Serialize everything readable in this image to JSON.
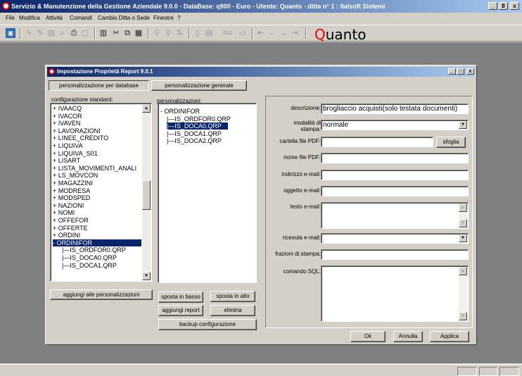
{
  "app": {
    "title": "Servizio & Manutenzione della Gestione Aziendale 9.0.0 - DataBase: q900 - Euro - Utente: Quanto - ditta n° 1 : Italsoft Sistemi",
    "window_buttons": [
      "_",
      "8",
      "x"
    ]
  },
  "menu": {
    "items": [
      "File",
      "Modifica",
      "Attività",
      "Comandi",
      "Cambio Ditta o Sede",
      "Finestre",
      "?"
    ]
  },
  "toolbar": {
    "dup_label": "dup",
    "brand_q": "Q",
    "brand_rest": "uanto",
    "brand_color": "#e00000"
  },
  "dialog": {
    "title": "Impostazione Proprietà Report 9.0.1",
    "tab_database": "personalizzazione per database",
    "tab_generale": "personalizzazione generale",
    "standard_label": "configurazione standard:",
    "custom_label": "personalizzazioni:",
    "standard_items": [
      "+ IVAACQ",
      "+ IVACOR",
      "+ IVAVEN",
      "+ LAVORAZIONI",
      "+ LINEE_CREDITO",
      "+ LIQUIVA",
      "+ LIQUIVA_S01",
      "+ LISART",
      "+ LISTA_MOVIMENTI_ANALI",
      "+ LS_MOVCON",
      "+ MAGAZZINI",
      "+ MODRESA",
      "+ MODSPED",
      "+ NAZIONI",
      "+ NOMI",
      "+ OFFEFOR",
      "+ OFFERTE",
      "+ ORDINI",
      "- ORDINIFOR",
      "|—IS_ORDFOR0.QRP",
      "|—IS_DOCA0.QRP",
      "|—IS_DOCA1.QRP"
    ],
    "standard_selected_index": 18,
    "custom_items": [
      "- ORDINIFOR",
      "|—IS_ORDFOR0.QRP",
      "|—IS_DOCA0.QRP",
      "|—IS_DOCA1.QRP",
      "|—IS_DOCA2.QRP"
    ],
    "custom_selected_index": 2,
    "buttons": {
      "aggiungi_personalizzazioni": "aggiungi alle personalizzazioni",
      "sposta_basso": "sposta in basso",
      "sposta_alto": "sposta in alto",
      "aggiungi_report": "aggiungi report",
      "elimina": "elimina",
      "backup": "backup configurazione",
      "ok": "Ok",
      "annulla": "Annulla",
      "applica": "Applica",
      "sfoglia": "sfoglia"
    },
    "form": {
      "descrizione_label": "descrizione:",
      "descrizione_value": "brogliaccio acquisti(solo testata documenti)",
      "modalita_label_1": "modalità di",
      "modalita_label_2": "stampa:",
      "modalita_value": "normale",
      "cartella_label": "cartella file PDF:",
      "cartella_value": "",
      "nome_label": "nome file PDF:",
      "nome_value": "",
      "indirizzo_label": "indirizzo e-mail:",
      "indirizzo_value": "",
      "oggetto_label": "oggetto e-mail:",
      "oggetto_value": "",
      "testo_label": "testo e-mail:",
      "testo_value": "",
      "ricevuta_label": "ricevuta e-mail:",
      "ricevuta_value": "",
      "frazioni_label": "frazioni di stampa:",
      "frazioni_value": "",
      "sql_label": "comando SQL:",
      "sql_value": ""
    }
  }
}
